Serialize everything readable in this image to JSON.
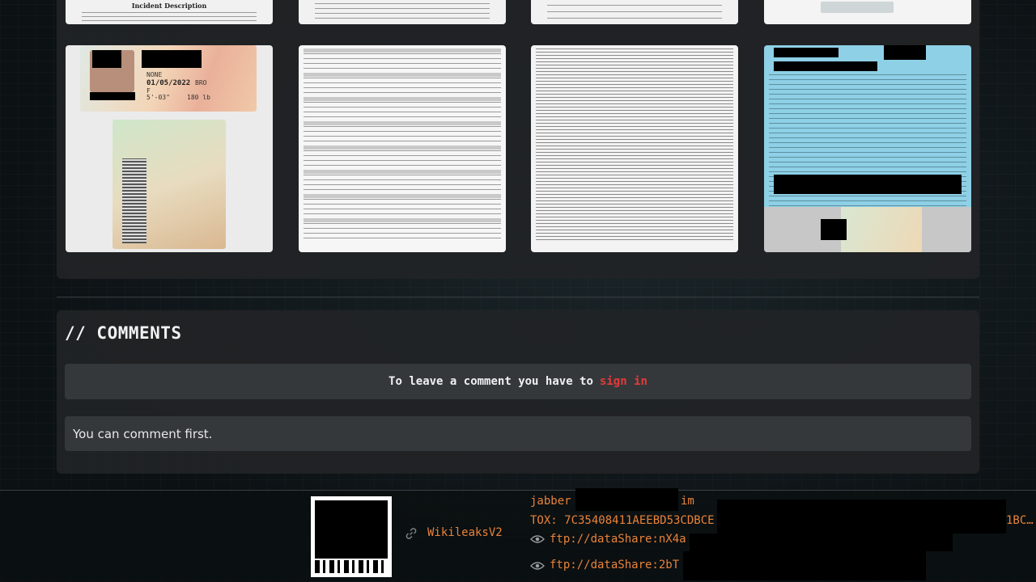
{
  "comments": {
    "heading": "// COMMENTS",
    "login_prompt": "To leave a comment you have to",
    "login_link": "sign in",
    "empty_message": "You can comment first."
  },
  "gallery": {
    "top_row_header": "Incident Description",
    "id_card_text": {
      "name_line": "NONE",
      "date": "01/05/2022",
      "height": "5'-03\"",
      "weight": "180 lb",
      "eyes": "BRO",
      "sex": "F"
    }
  },
  "footer": {
    "project_link": "WikileaksV2",
    "jabber_prefix": "jabber",
    "jabber_suffix": ".im",
    "tox_prefix": "TOX: 7C35408411AEEBD53CDBCE",
    "tox_suffix": "1BC…",
    "ftp_1": "ftp://dataShare:nX4a",
    "ftp_2": "ftp://dataShare:2bT"
  }
}
